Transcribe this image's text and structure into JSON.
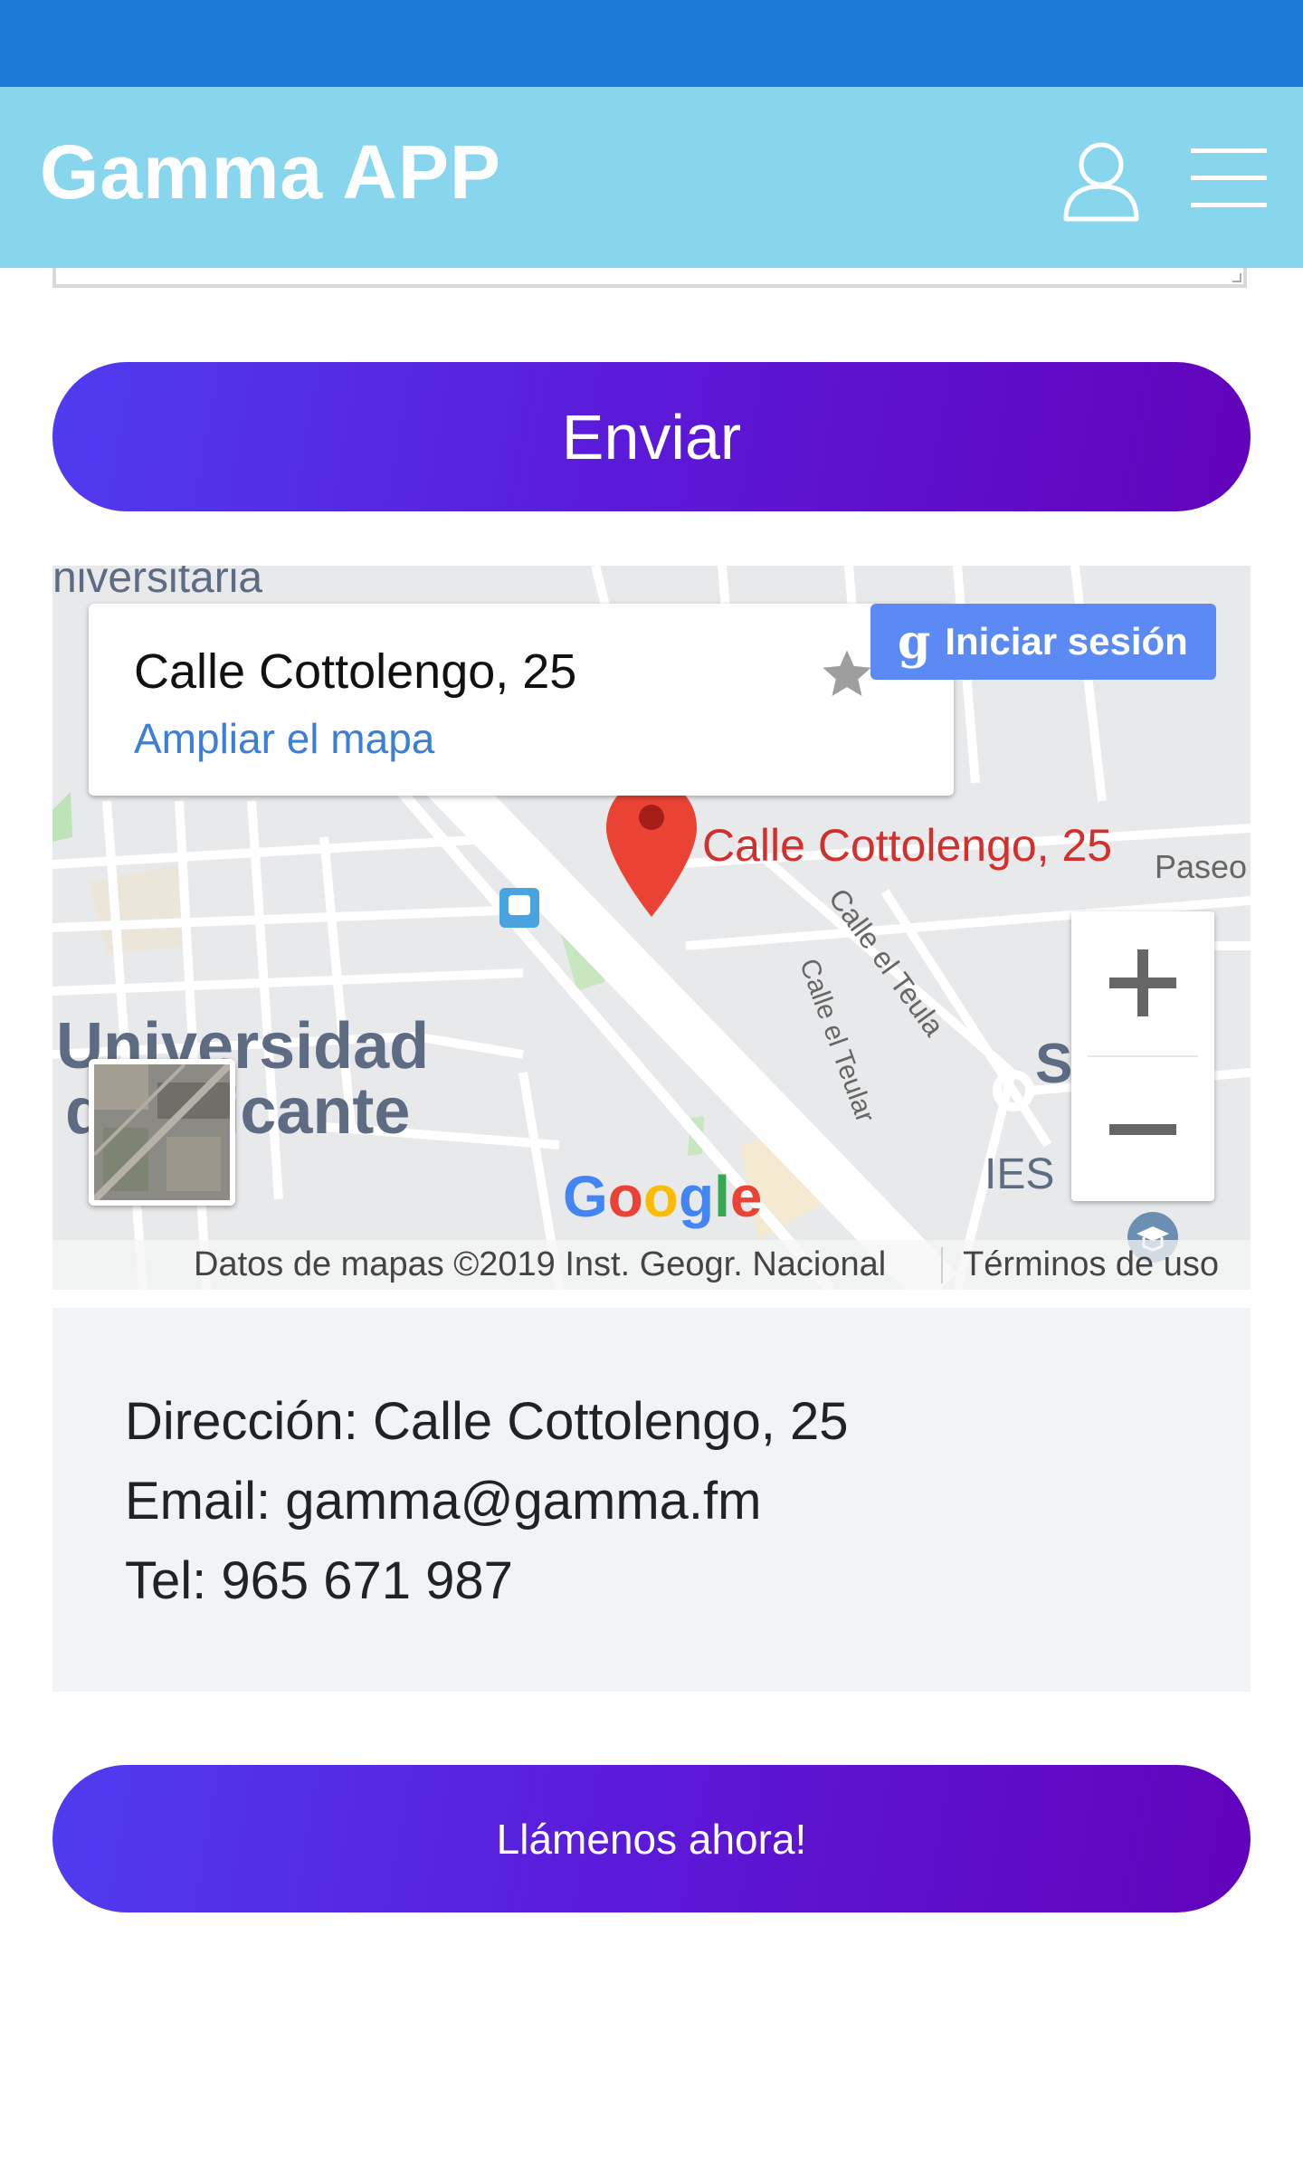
{
  "header": {
    "title": "Gamma APP",
    "status_bar_color": "#1e79d4",
    "header_color": "#88d5ee",
    "user_icon": "user-icon",
    "menu_icon": "hamburger-menu-icon"
  },
  "form": {
    "send_label": "Enviar"
  },
  "map": {
    "card_title": "Calle Cottolengo, 25",
    "card_link": "Ampliar el mapa",
    "signin_icon": "g",
    "signin_label": "Iniciar sesión",
    "pin_label": "Calle Cottolengo, 25",
    "labels": {
      "paseo": "Paseo",
      "teula": "Calle el Teula",
      "teular": "Calle el Teular",
      "univ_line1": "Universidad",
      "univ_line2": "de Alicante",
      "univ_top": "niversitaria",
      "ies": "IES",
      "sa": "S    A"
    },
    "zoom_in": "+",
    "zoom_out": "−",
    "google": [
      "G",
      "o",
      "o",
      "g",
      "l",
      "e"
    ],
    "attribution": "Datos de mapas ©2019 Inst. Geogr. Nacional",
    "terms": "Términos de uso",
    "pin_color": "#ea4335"
  },
  "contact": {
    "address": "Dirección: Calle Cottolengo, 25",
    "email": "Email: gamma@gamma.fm",
    "phone": "Tel: 965 671 987"
  },
  "cta": {
    "call_label": "Llámenos ahora!"
  },
  "colors": {
    "button_gradient_start": "#4f3cf0",
    "button_gradient_end": "#6203bb",
    "link_blue": "#3b7fd6",
    "contact_bg": "#f1f4f7"
  }
}
